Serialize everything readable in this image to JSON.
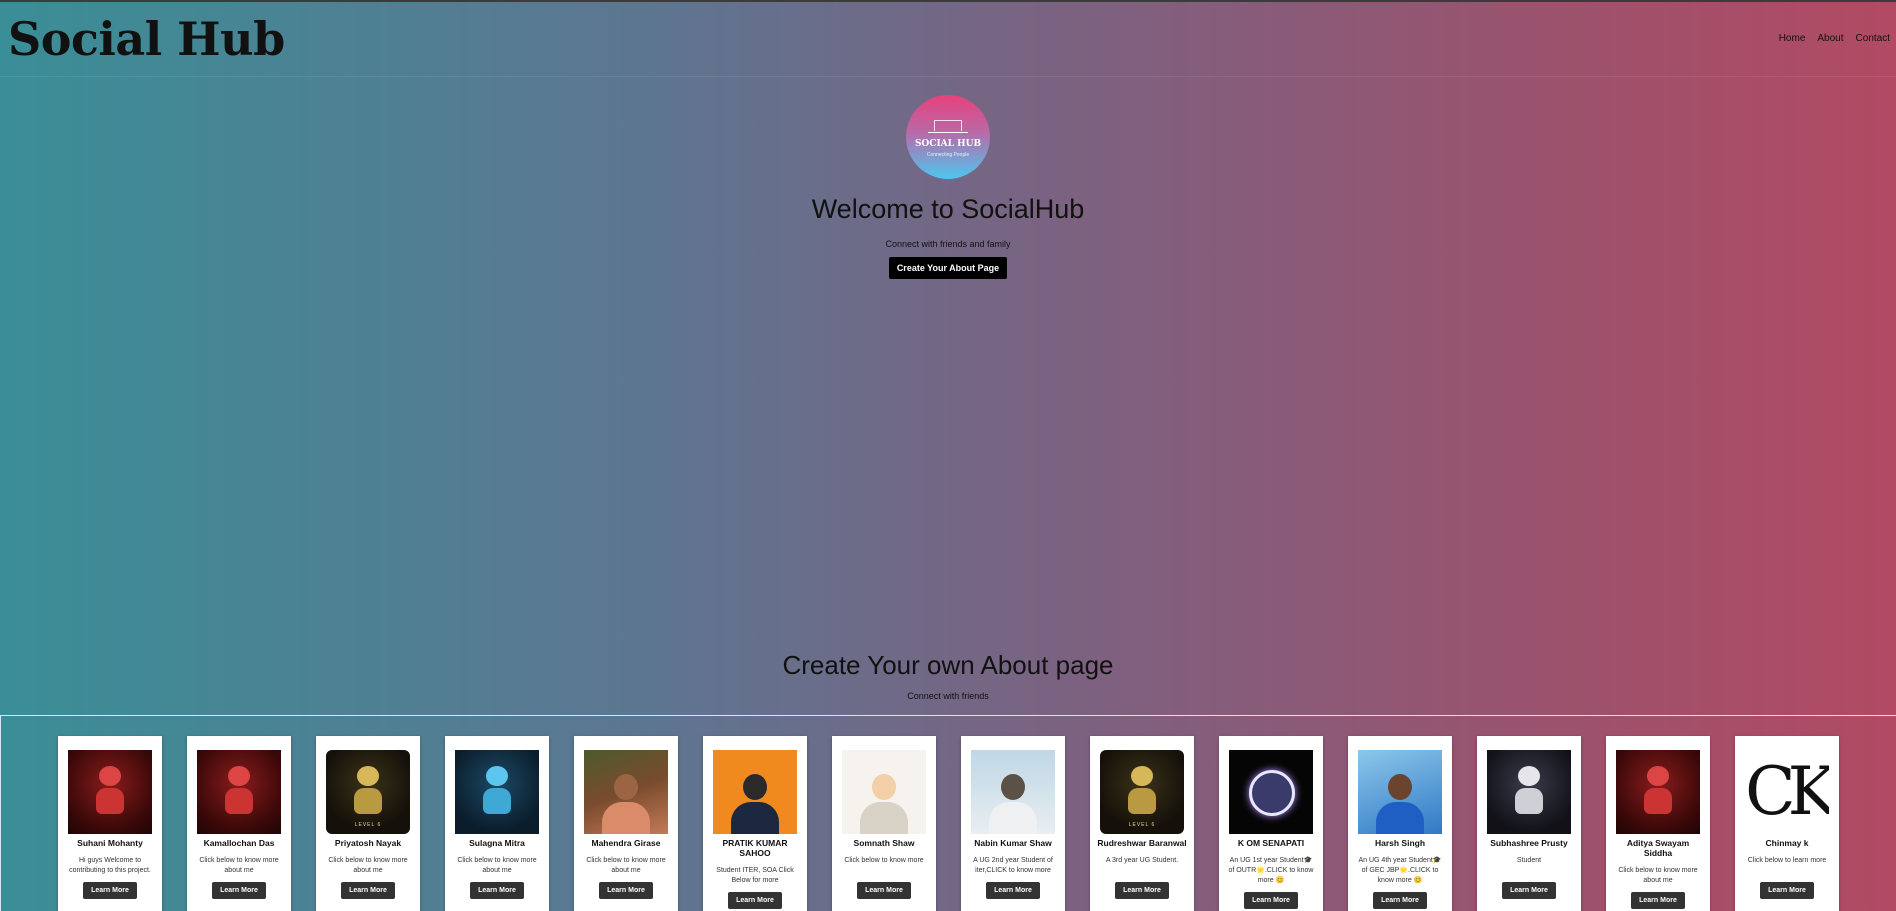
{
  "header": {
    "brand": "Social Hub",
    "nav": [
      "Home",
      "About",
      "Contact"
    ]
  },
  "hero": {
    "logo_title": "SOCIAL HUB",
    "logo_subtitle": "Connecting People",
    "title": "Welcome to SocialHub",
    "subtitle": "Connect with friends and family",
    "cta_label": "Create Your About Page"
  },
  "own_section": {
    "title": "Create Your own About page",
    "subtitle": "Connect with friends"
  },
  "cards": [
    {
      "name": "Suhani Mohanty",
      "desc": "Hi guys Welcome to contributing to this project.",
      "button": "Learn More",
      "avatar": "red-astronaut"
    },
    {
      "name": "Kamallochan Das",
      "desc": "Click below to know more about me",
      "button": "Learn More",
      "avatar": "red-astronaut"
    },
    {
      "name": "Priyatosh Nayak",
      "desc": "Click below to know more about me",
      "button": "Learn More",
      "avatar": "gold-astronaut",
      "badge": "LEVEL 6"
    },
    {
      "name": "Sulagna Mitra",
      "desc": "Click below to know more about me",
      "button": "Learn More",
      "avatar": "cyan-astronaut"
    },
    {
      "name": "Mahendra Girase",
      "desc": "Click below to know more about me",
      "button": "Learn More",
      "avatar": "photo-man"
    },
    {
      "name": "PRATIK KUMAR SAHOO",
      "desc": "Student ITER, SOA Click Below for more",
      "button": "Learn More",
      "avatar": "masked-man"
    },
    {
      "name": "Somnath Shaw",
      "desc": "Click below to know more",
      "button": "Learn More",
      "avatar": "cartoon-boy"
    },
    {
      "name": "Nabin Kumar Shaw",
      "desc": "A UG 2nd year Student of iter,CLICK to know more",
      "button": "Learn More",
      "avatar": "anime-boy"
    },
    {
      "name": "Rudreshwar Baranwal",
      "desc": "A 3rd year UG Student.",
      "button": "Learn More",
      "avatar": "gold-astronaut",
      "badge": "LEVEL 6"
    },
    {
      "name": "K OM SENAPATI",
      "desc": "An UG 1st year Student🎓 of OUTR🌟.CLICK to know more 😊",
      "button": "Learn More",
      "avatar": "neon-ring"
    },
    {
      "name": "Harsh Singh",
      "desc": "An UG 4th year Student🎓 of GEC JBP🌟.CLICK to know more 😊",
      "button": "Learn More",
      "avatar": "photo-thumbs"
    },
    {
      "name": "Subhashree Prusty",
      "desc": "Student",
      "button": "Learn More",
      "avatar": "white-astronaut"
    },
    {
      "name": "Aditya Swayam Siddha",
      "desc": "Click below to know more about me",
      "button": "Learn More",
      "avatar": "red-astronaut"
    },
    {
      "name": "Chinmay k",
      "desc": "Click below to learn more",
      "button": "Learn More",
      "avatar": "ck-logo",
      "logo_text": "CK"
    }
  ]
}
